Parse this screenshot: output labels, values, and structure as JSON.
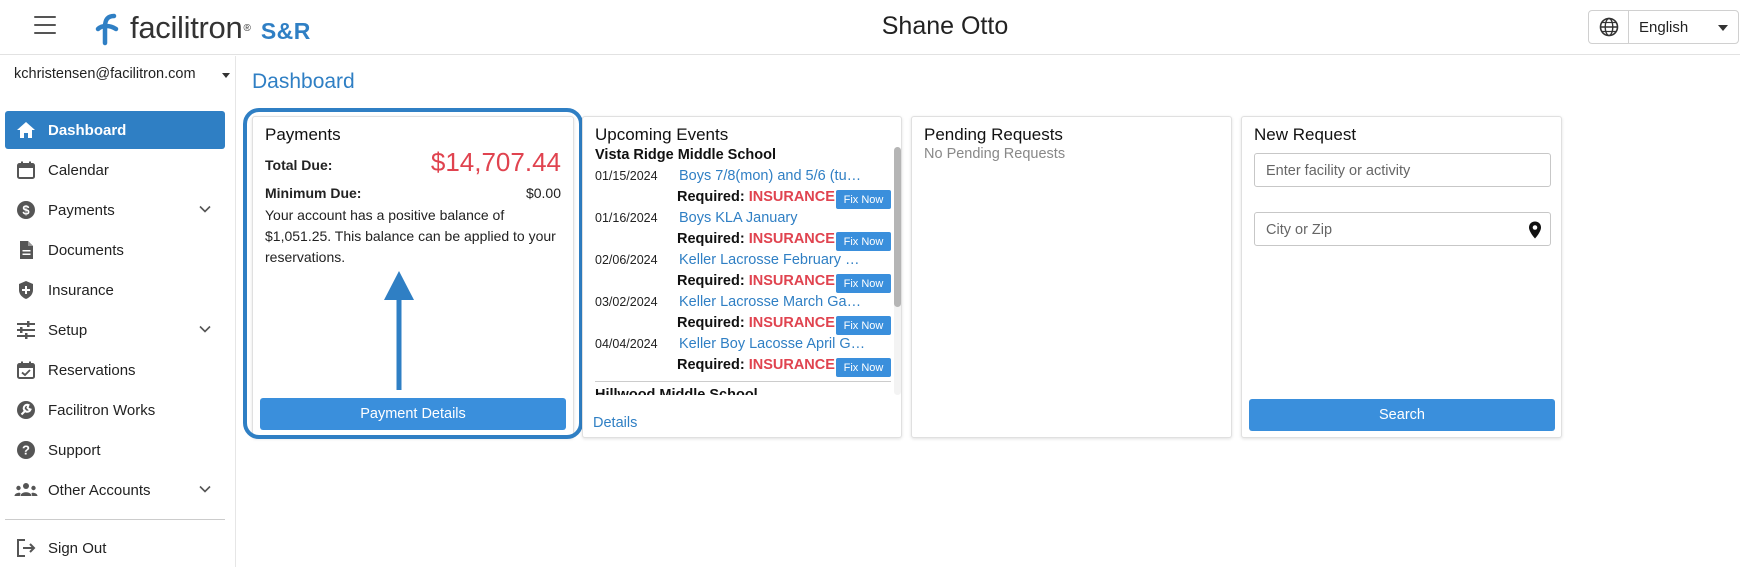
{
  "header": {
    "brand": "facilitron",
    "brand_mark": "®",
    "product": "S&R",
    "user_name": "Shane Otto",
    "language": "English",
    "globe_icon": "globe-icon",
    "menu_icon": "hamburger-icon"
  },
  "sidebar": {
    "account_email": "kchristensen@facilitron.com",
    "items": [
      {
        "label": "Dashboard",
        "icon": "home-icon",
        "active": true
      },
      {
        "label": "Calendar",
        "icon": "calendar-icon"
      },
      {
        "label": "Payments",
        "icon": "dollar-icon",
        "expandable": true
      },
      {
        "label": "Documents",
        "icon": "document-icon"
      },
      {
        "label": "Insurance",
        "icon": "shield-icon"
      },
      {
        "label": "Setup",
        "icon": "sliders-icon",
        "expandable": true
      },
      {
        "label": "Reservations",
        "icon": "calendar-check-icon"
      },
      {
        "label": "Facilitron Works",
        "icon": "wrench-icon"
      },
      {
        "label": "Support",
        "icon": "help-icon"
      },
      {
        "label": "Other Accounts",
        "icon": "people-icon",
        "expandable": true
      },
      {
        "label": "Sign Out",
        "icon": "sign-out-icon"
      }
    ]
  },
  "main": {
    "page_title": "Dashboard",
    "payments": {
      "title": "Payments",
      "total_due_label": "Total Due:",
      "total_due": "$14,707.44",
      "minimum_due_label": "Minimum Due:",
      "minimum_due": "$0.00",
      "note": "Your account has a positive balance of $1,051.25. This balance can be applied to your reservations.",
      "button": "Payment Details"
    },
    "upcoming": {
      "title": "Upcoming Events",
      "school": "Vista Ridge Middle School",
      "required_label": "Required",
      "required_value": "INSURANCE",
      "fix_label": "Fix Now",
      "events": [
        {
          "date": "01/15/2024",
          "name": "Boys 7/8(mon) and 5/6 (tu…"
        },
        {
          "date": "01/16/2024",
          "name": "Boys KLA January"
        },
        {
          "date": "02/06/2024",
          "name": "Keller Lacrosse February …"
        },
        {
          "date": "03/02/2024",
          "name": "Keller Lacrosse March Ga…"
        },
        {
          "date": "04/04/2024",
          "name": "Keller Boy Lacosse April G…"
        }
      ],
      "next_school": "Hillwood Middle School",
      "details_link": "Details"
    },
    "pending": {
      "title": "Pending Requests",
      "empty": "No Pending Requests"
    },
    "new_request": {
      "title": "New Request",
      "facility_placeholder": "Enter facility or activity",
      "city_placeholder": "City or Zip",
      "search_button": "Search",
      "pin_icon": "map-pin-icon"
    }
  },
  "colors": {
    "brand_blue": "#2f7fc4",
    "button_blue": "#3a8fdc",
    "alert_red": "#e0434f"
  }
}
